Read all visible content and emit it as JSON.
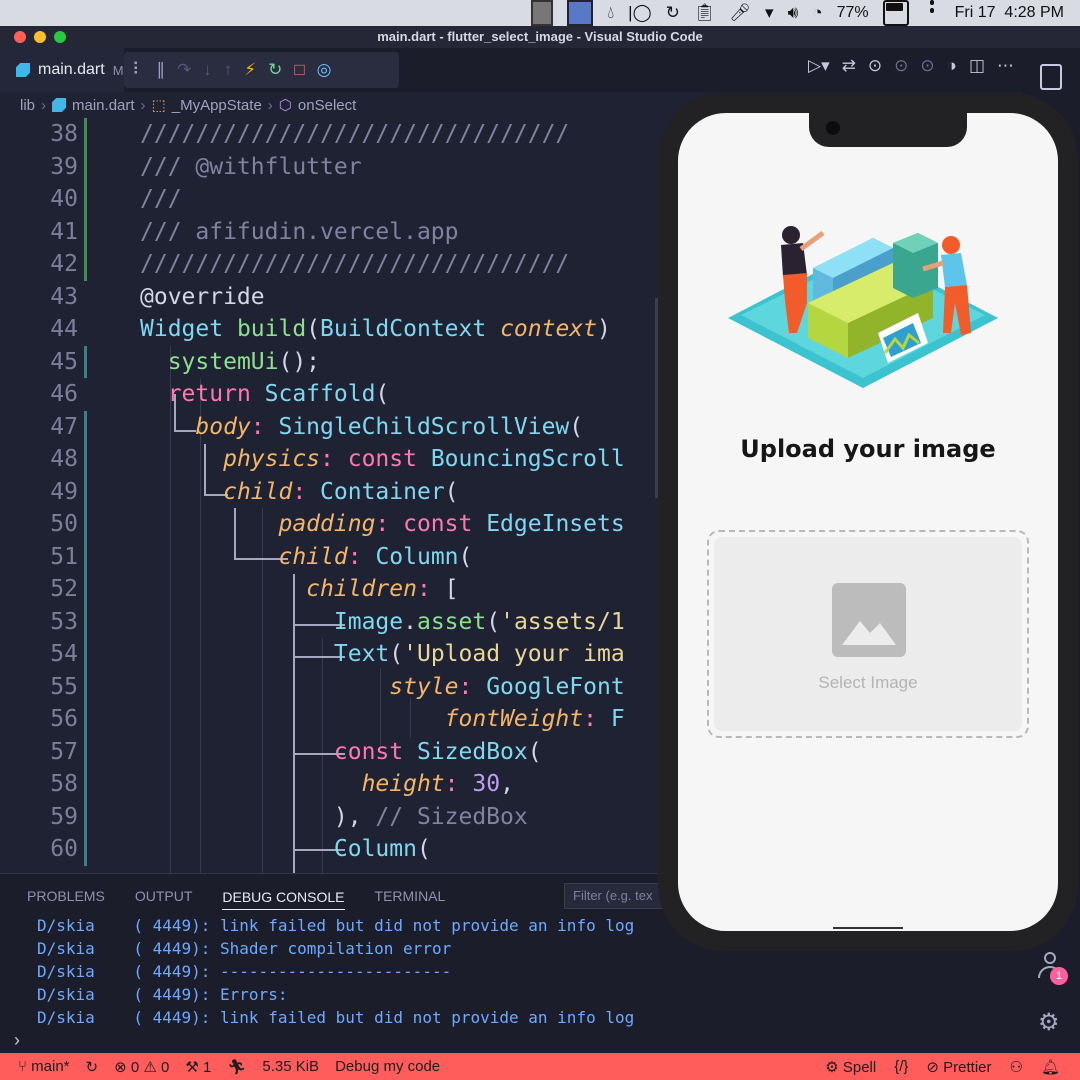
{
  "menubar": {
    "battery": "77%",
    "clock": "Fri 17  4:28 PM"
  },
  "window": {
    "title": "main.dart - flutter_select_image - Visual Studio Code"
  },
  "tab": {
    "label": "main.dart",
    "suffix": "M"
  },
  "breadcrumb": {
    "items": [
      "lib",
      "main.dart",
      "_MyAppState",
      "onSelect"
    ]
  },
  "editor": {
    "lines": [
      {
        "n": "38",
        "tokens": [
          {
            "t": "c",
            "v": "///////////////////////////////"
          }
        ]
      },
      {
        "n": "39",
        "tokens": [
          {
            "t": "c",
            "v": "/// @withflutter"
          }
        ]
      },
      {
        "n": "40",
        "tokens": [
          {
            "t": "c",
            "v": "///"
          }
        ]
      },
      {
        "n": "41",
        "tokens": [
          {
            "t": "c",
            "v": "/// afifudin.vercel.app"
          }
        ]
      },
      {
        "n": "42",
        "tokens": [
          {
            "t": "c",
            "v": "///////////////////////////////"
          }
        ]
      },
      {
        "n": "43",
        "tokens": [
          {
            "t": "p",
            "v": "@override"
          }
        ]
      },
      {
        "n": "44",
        "tokens": [
          {
            "t": "ty",
            "v": "Widget "
          },
          {
            "t": "f",
            "v": "build"
          },
          {
            "t": "p",
            "v": "("
          },
          {
            "t": "ty",
            "v": "BuildContext "
          },
          {
            "t": "i",
            "v": "context"
          },
          {
            "t": "p",
            "v": ")"
          }
        ]
      },
      {
        "n": "45",
        "tokens": [
          {
            "t": "p",
            "v": "  "
          },
          {
            "t": "f",
            "v": "systemUi"
          },
          {
            "t": "p",
            "v": "();"
          }
        ]
      },
      {
        "n": "46",
        "tokens": [
          {
            "t": "p",
            "v": "  "
          },
          {
            "t": "k",
            "v": "return "
          },
          {
            "t": "ty",
            "v": "Scaffold"
          },
          {
            "t": "p",
            "v": "("
          }
        ]
      },
      {
        "n": "47",
        "tokens": [
          {
            "t": "p",
            "v": "    "
          },
          {
            "t": "i",
            "v": "body"
          },
          {
            "t": "k",
            "v": ": "
          },
          {
            "t": "ty",
            "v": "SingleChildScrollView"
          },
          {
            "t": "p",
            "v": "("
          }
        ]
      },
      {
        "n": "48",
        "tokens": [
          {
            "t": "p",
            "v": "      "
          },
          {
            "t": "i",
            "v": "physics"
          },
          {
            "t": "k",
            "v": ": const "
          },
          {
            "t": "ty",
            "v": "BouncingScroll"
          }
        ]
      },
      {
        "n": "49",
        "tokens": [
          {
            "t": "p",
            "v": "      "
          },
          {
            "t": "i",
            "v": "child"
          },
          {
            "t": "k",
            "v": ": "
          },
          {
            "t": "ty",
            "v": "Container"
          },
          {
            "t": "p",
            "v": "("
          }
        ]
      },
      {
        "n": "50",
        "tokens": [
          {
            "t": "p",
            "v": "          "
          },
          {
            "t": "i",
            "v": "padding"
          },
          {
            "t": "k",
            "v": ": const "
          },
          {
            "t": "ty",
            "v": "EdgeInsets"
          }
        ]
      },
      {
        "n": "51",
        "tokens": [
          {
            "t": "p",
            "v": "          "
          },
          {
            "t": "i",
            "v": "child"
          },
          {
            "t": "k",
            "v": ": "
          },
          {
            "t": "ty",
            "v": "Column"
          },
          {
            "t": "p",
            "v": "("
          }
        ]
      },
      {
        "n": "52",
        "tokens": [
          {
            "t": "p",
            "v": "            "
          },
          {
            "t": "i",
            "v": "children"
          },
          {
            "t": "k",
            "v": ": "
          },
          {
            "t": "p",
            "v": "["
          }
        ]
      },
      {
        "n": "53",
        "tokens": [
          {
            "t": "p",
            "v": "              "
          },
          {
            "t": "ty",
            "v": "Image"
          },
          {
            "t": "p",
            "v": "."
          },
          {
            "t": "f",
            "v": "asset"
          },
          {
            "t": "p",
            "v": "("
          },
          {
            "t": "s",
            "v": "'assets/1"
          }
        ]
      },
      {
        "n": "54",
        "tokens": [
          {
            "t": "p",
            "v": "              "
          },
          {
            "t": "ty",
            "v": "Text"
          },
          {
            "t": "p",
            "v": "("
          },
          {
            "t": "s",
            "v": "'Upload your ima"
          }
        ]
      },
      {
        "n": "55",
        "tokens": [
          {
            "t": "p",
            "v": "                  "
          },
          {
            "t": "i",
            "v": "style"
          },
          {
            "t": "k",
            "v": ": "
          },
          {
            "t": "ty",
            "v": "GoogleFont"
          }
        ]
      },
      {
        "n": "56",
        "tokens": [
          {
            "t": "p",
            "v": "                      "
          },
          {
            "t": "i",
            "v": "fontWeight"
          },
          {
            "t": "k",
            "v": ": "
          },
          {
            "t": "ty",
            "v": "F"
          }
        ]
      },
      {
        "n": "57",
        "tokens": [
          {
            "t": "p",
            "v": "              "
          },
          {
            "t": "k",
            "v": "const "
          },
          {
            "t": "ty",
            "v": "SizedBox"
          },
          {
            "t": "p",
            "v": "("
          }
        ]
      },
      {
        "n": "58",
        "tokens": [
          {
            "t": "p",
            "v": "                "
          },
          {
            "t": "i",
            "v": "height"
          },
          {
            "t": "k",
            "v": ": "
          },
          {
            "t": "n",
            "v": "30"
          },
          {
            "t": "p",
            "v": ","
          }
        ]
      },
      {
        "n": "59",
        "tokens": [
          {
            "t": "p",
            "v": "              ), "
          },
          {
            "t": "c2",
            "v": "// SizedBox"
          }
        ]
      },
      {
        "n": "60",
        "tokens": [
          {
            "t": "p",
            "v": "              "
          },
          {
            "t": "ty",
            "v": "Column"
          },
          {
            "t": "p",
            "v": "("
          }
        ]
      }
    ]
  },
  "panel": {
    "tabs": [
      "PROBLEMS",
      "OUTPUT",
      "DEBUG CONSOLE",
      "TERMINAL"
    ],
    "active_tab": "DEBUG CONSOLE",
    "filter_placeholder": "Filter (e.g. tex",
    "logs": [
      "D/skia    ( 4449): link failed but did not provide an info log",
      "D/skia    ( 4449): Shader compilation error",
      "D/skia    ( 4449): ------------------------",
      "D/skia    ( 4449): Errors:",
      "D/skia    ( 4449): link failed but did not provide an info log"
    ]
  },
  "activity": {
    "badge": "1"
  },
  "statusbar": {
    "branch": "main*",
    "errors": "0",
    "warnings": "0",
    "tools": "1",
    "size": "5.35 KiB",
    "debug": "Debug my code",
    "spell": "Spell",
    "prettier": "Prettier"
  },
  "phone": {
    "title": "Upload your image",
    "select_label": "Select Image"
  },
  "colors": {
    "accent_status": "#ff5c5c",
    "editor_bg": "#1f2233",
    "log_text": "#6ea9ff"
  }
}
